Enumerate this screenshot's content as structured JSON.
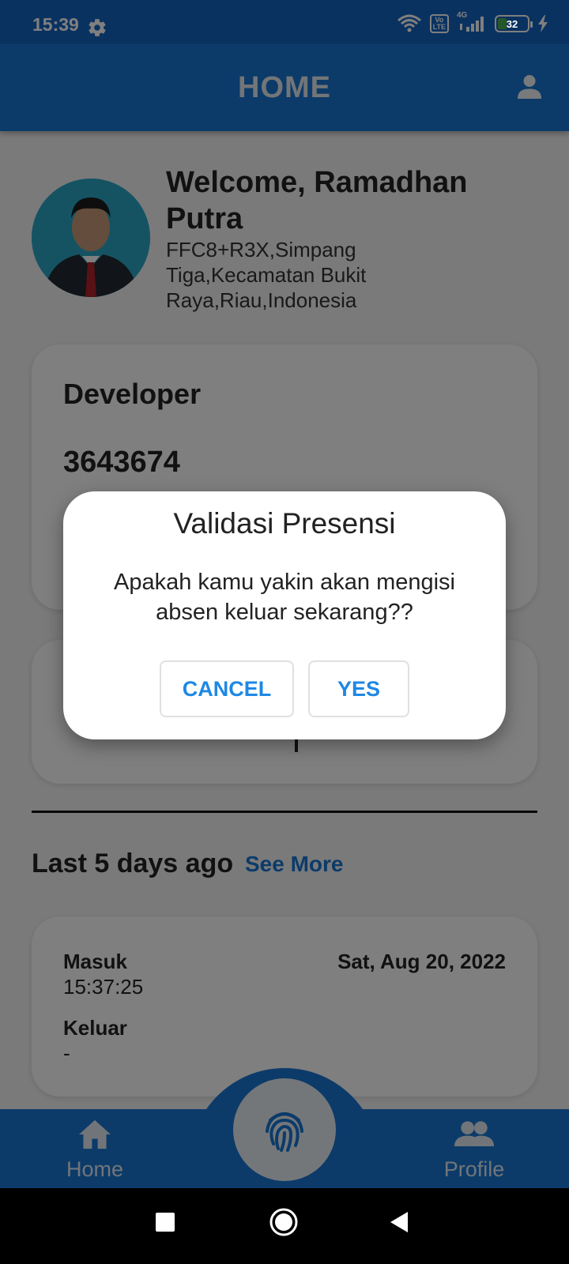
{
  "status_bar": {
    "time": "15:39",
    "battery": "32",
    "network": "4G",
    "icons": [
      "gear-icon",
      "wifi-icon",
      "volte-icon",
      "signal-icon",
      "battery-icon",
      "charging-icon"
    ]
  },
  "app_bar": {
    "title": "HOME",
    "profile_icon": "person-icon"
  },
  "user": {
    "welcome": "Welcome, Ramadhan Putra",
    "address": "FFC8+R3X,Simpang Tiga,Kecamatan Bukit Raya,Riau,Indonesia"
  },
  "info_card": {
    "role": "Developer",
    "code": "3643674"
  },
  "history": {
    "heading": "Last 5 days ago",
    "see_more": "See More",
    "entries": [
      {
        "in_label": "Masuk",
        "in_time": "15:37:25",
        "date": "Sat, Aug 20, 2022",
        "out_label": "Keluar",
        "out_time": "-"
      }
    ]
  },
  "bottom_nav": {
    "home_label": "Home",
    "profile_label": "Profile",
    "fab_icon": "fingerprint-icon"
  },
  "dialog": {
    "title": "Validasi Presensi",
    "message": "Apakah kamu yakin akan mengisi absen keluar sekarang??",
    "cancel_label": "CANCEL",
    "yes_label": "YES"
  },
  "colors": {
    "primary": "#1976d2",
    "status_bar": "#1565c0",
    "dialog_button_text": "#1e88e5"
  }
}
